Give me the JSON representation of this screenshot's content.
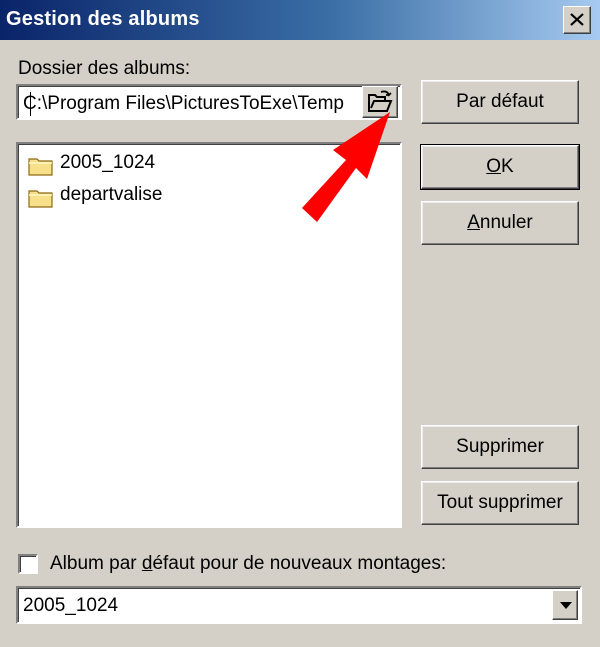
{
  "window": {
    "title": "Gestion des albums"
  },
  "folder": {
    "label": "Dossier des albums:",
    "path": "C:\\Program Files\\PicturesToExe\\Temp"
  },
  "albums": [
    {
      "label": "2005_1024"
    },
    {
      "label": "departvalise"
    }
  ],
  "buttons": {
    "default": "Par défaut",
    "ok_u": "O",
    "ok_rest": "K",
    "cancel_u": "A",
    "cancel_rest": "nnuler",
    "delete": "Supprimer",
    "delete_all": "Tout supprimer"
  },
  "checkbox": {
    "label_pre": "Album par ",
    "label_u": "d",
    "label_post": "éfaut pour de nouveaux montages:",
    "checked": false
  },
  "combo": {
    "value": "2005_1024"
  },
  "colors": {
    "title_start": "#0a246a",
    "title_end": "#a6caf0",
    "arrow": "#ff0000"
  }
}
